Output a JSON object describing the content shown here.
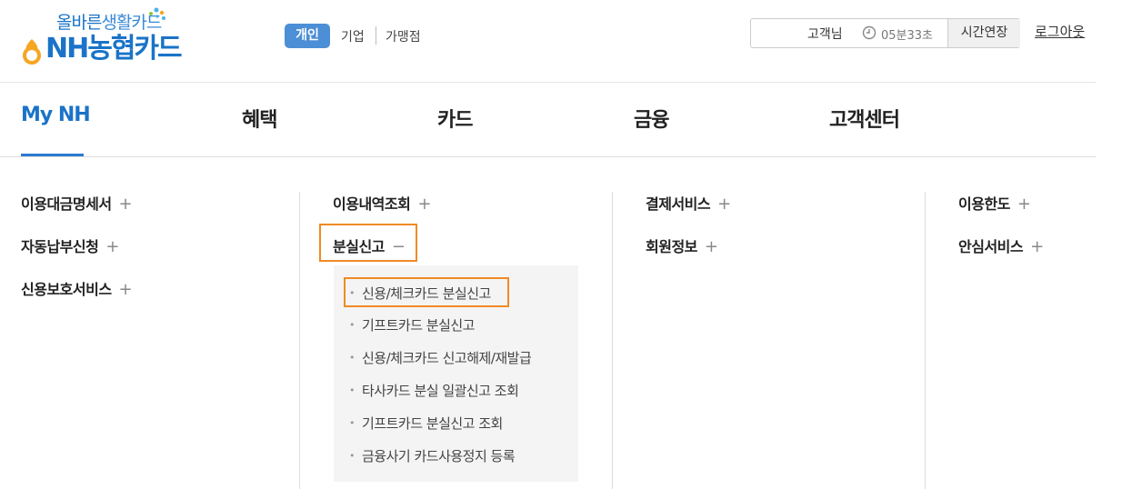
{
  "header": {
    "logo_tagline_main": "올바른",
    "logo_tagline_sub": "생활카드",
    "logo_brand": "NH농협카드",
    "segments": {
      "active": "개인",
      "corporate": "기업",
      "merchant": "가맹점"
    },
    "session": {
      "user": "고객님",
      "timer": "05분33초",
      "extend_label": "시간연장"
    },
    "logout_label": "로그아웃"
  },
  "nav": {
    "items": [
      "My NH",
      "혜택",
      "카드",
      "금융",
      "고객센터"
    ],
    "active": "My NH"
  },
  "menu": {
    "col1": [
      {
        "label": "이용대금명세서",
        "toggle": "+"
      },
      {
        "label": "자동납부신청",
        "toggle": "+"
      },
      {
        "label": "신용보호서비스",
        "toggle": "+"
      }
    ],
    "col2": [
      {
        "label": "이용내역조회",
        "toggle": "+"
      },
      {
        "label": "분실신고",
        "toggle": "−"
      }
    ],
    "col2_sub": [
      "신용/체크카드 분실신고",
      "기프트카드 분실신고",
      "신용/체크카드 신고해제/재발급",
      "타사카드 분실 일괄신고 조회",
      "기프트카드 분실신고 조회",
      "금융사기 카드사용정지 등록"
    ],
    "col3": [
      {
        "label": "결제서비스",
        "toggle": "+"
      },
      {
        "label": "회원정보",
        "toggle": "+"
      }
    ],
    "col4": [
      {
        "label": "이용한도",
        "toggle": "+"
      },
      {
        "label": "안심서비스",
        "toggle": "+"
      }
    ]
  },
  "colors": {
    "brand_blue": "#1a73c8",
    "highlight_orange": "#f08a24",
    "segment_active": "#4d8fd6"
  }
}
